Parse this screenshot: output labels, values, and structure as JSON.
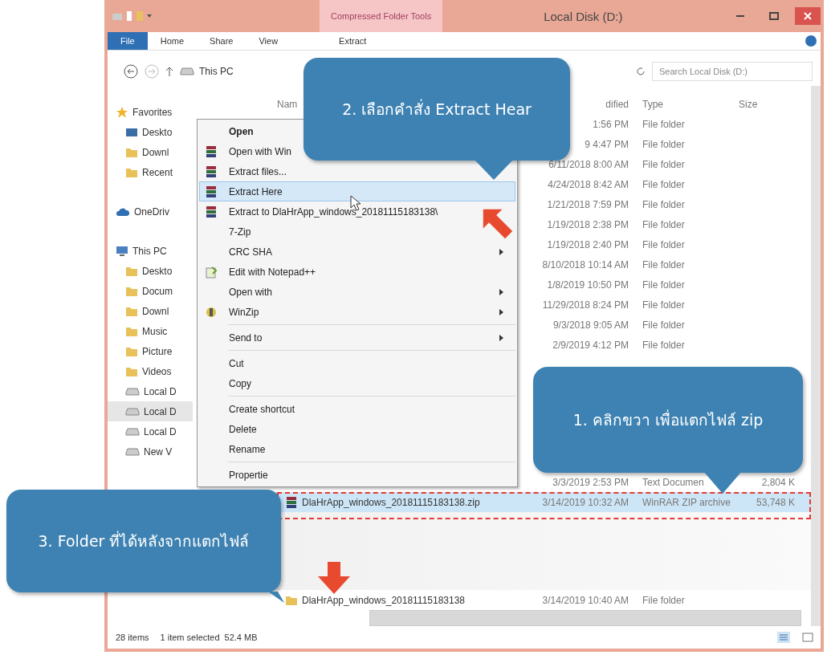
{
  "window": {
    "context_tab": "Compressed Folder Tools",
    "title": "Local Disk (D:)"
  },
  "ribbon_tabs": [
    {
      "label": "File",
      "selected": true
    },
    {
      "label": "Home",
      "selected": false
    },
    {
      "label": "Share",
      "selected": false
    },
    {
      "label": "View",
      "selected": false
    },
    {
      "label": "Extract",
      "selected": false
    }
  ],
  "address_bar": {
    "path": "This PC",
    "search_placeholder": "Search Local Disk (D:)"
  },
  "nav_pane": [
    {
      "label": "Favorites",
      "kind": "star",
      "selected": false,
      "children": [
        {
          "label": "Deskto",
          "kind": "desktop",
          "selected": false
        },
        {
          "label": "Downl",
          "kind": "folder",
          "selected": false
        },
        {
          "label": "Recent",
          "kind": "folder",
          "selected": false
        }
      ]
    },
    {
      "label": "OneDriv",
      "kind": "cloud",
      "selected": false
    },
    {
      "label": "This PC",
      "kind": "computer",
      "selected": false,
      "children": [
        {
          "label": "Deskto",
          "kind": "folder",
          "selected": false
        },
        {
          "label": "Docum",
          "kind": "folder",
          "selected": false
        },
        {
          "label": "Downl",
          "kind": "folder",
          "selected": false
        },
        {
          "label": "Music",
          "kind": "folder",
          "selected": false
        },
        {
          "label": "Picture",
          "kind": "folder",
          "selected": false
        },
        {
          "label": "Videos",
          "kind": "folder",
          "selected": false
        },
        {
          "label": "Local D",
          "kind": "drive",
          "selected": false
        },
        {
          "label": "Local D",
          "kind": "drive",
          "selected": true
        },
        {
          "label": "Local D",
          "kind": "drive",
          "selected": false
        },
        {
          "label": "New V",
          "kind": "drive",
          "selected": false
        }
      ]
    }
  ],
  "file_list": {
    "columns": [
      "Nam",
      "dified",
      "Type",
      "Size"
    ],
    "rows": [
      {
        "kind": "folder",
        "modified": "1:56 PM",
        "type": "File folder",
        "selected": false
      },
      {
        "kind": "folder",
        "modified": "9 4:47 PM",
        "type": "File folder",
        "selected": false
      },
      {
        "kind": "folder",
        "modified": "6/11/2018 8:00 AM",
        "type": "File folder",
        "selected": false
      },
      {
        "kind": "folder",
        "modified": "4/24/2018 8:42 AM",
        "type": "File folder",
        "selected": false
      },
      {
        "kind": "folder",
        "modified": "1/21/2018 7:59 PM",
        "type": "File folder",
        "selected": false
      },
      {
        "kind": "folder",
        "modified": "1/19/2018 2:38 PM",
        "type": "File folder",
        "selected": false
      },
      {
        "kind": "folder",
        "modified": "1/19/2018 2:40 PM",
        "type": "File folder",
        "selected": false
      },
      {
        "kind": "folder",
        "modified": "8/10/2018 10:14 AM",
        "type": "File folder",
        "selected": false
      },
      {
        "kind": "folder",
        "modified": "1/8/2019 10:50 PM",
        "type": "File folder",
        "selected": false
      },
      {
        "kind": "folder",
        "modified": "11/29/2018 8:24 PM",
        "type": "File folder",
        "selected": false
      },
      {
        "kind": "folder",
        "modified": "9/3/2018 9:05 AM",
        "type": "File folder",
        "selected": false
      },
      {
        "kind": "folder",
        "modified": "2/9/2019 4:12 PM",
        "type": "File folder",
        "selected": false
      },
      {
        "kind": "gap"
      },
      {
        "kind": "text",
        "modified": "3/3/2019 2:53 PM",
        "type": "Text Documen",
        "size": "2,804 K",
        "selected": false
      },
      {
        "kind": "archive",
        "name": "DlaHrApp_windows_20181115183138.zip",
        "modified": "3/14/2019 10:32 AM",
        "type": "WinRAR ZIP archive",
        "size": "53,748 K",
        "selected": true
      },
      {
        "kind": "blurred"
      },
      {
        "kind": "folder",
        "name": "DlaHrApp_windows_20181115183138",
        "modified": "3/14/2019 10:40 AM",
        "type": "File folder",
        "selected": false
      }
    ]
  },
  "context_menu": [
    {
      "kind": "plain",
      "label": "Open",
      "default": true
    },
    {
      "kind": "archive",
      "label": "Open with Win"
    },
    {
      "kind": "archive",
      "label": "Extract files..."
    },
    {
      "kind": "archive",
      "label": "Extract Here",
      "selected": true
    },
    {
      "kind": "archive",
      "label": "Extract to DlaHrApp_windows_20181115183138\\"
    },
    {
      "kind": "plain",
      "label": "7-Zip"
    },
    {
      "kind": "plain",
      "label": "CRC SHA",
      "submenu": true
    },
    {
      "kind": "notepad",
      "label": "Edit with Notepad++"
    },
    {
      "kind": "plain",
      "label": "Open with",
      "submenu": true
    },
    {
      "kind": "winzip",
      "label": "WinZip",
      "submenu": true
    },
    {
      "kind": "separator"
    },
    {
      "kind": "plain",
      "label": "Send to",
      "submenu": true
    },
    {
      "kind": "separator"
    },
    {
      "kind": "plain",
      "label": "Cut"
    },
    {
      "kind": "plain",
      "label": "Copy"
    },
    {
      "kind": "separator"
    },
    {
      "kind": "plain",
      "label": "Create shortcut"
    },
    {
      "kind": "plain",
      "label": "Delete"
    },
    {
      "kind": "plain",
      "label": "Rename"
    },
    {
      "kind": "separator"
    },
    {
      "kind": "plain",
      "label": "Propertie"
    }
  ],
  "callouts": [
    {
      "text": "2. เลือกคำสั่ง Extract Hear"
    },
    {
      "text": "1. คลิกขวา เพื่อแตกไฟล์ zip"
    },
    {
      "text": "3. Folder ที่ได้หลังจากแตกไฟล์"
    }
  ],
  "status_bar": {
    "item_count": "28 items",
    "selection": "1 item selected",
    "size": "52.4 MB"
  }
}
